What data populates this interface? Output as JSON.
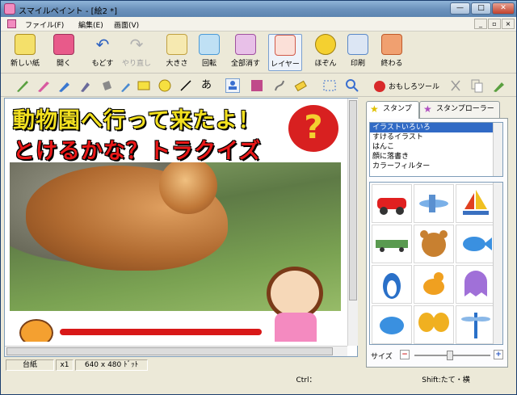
{
  "window": {
    "title": "スマイルペイント - [絵2 *]",
    "min": "—",
    "max": "□",
    "close": "✕"
  },
  "menu": {
    "items": [
      "ファイル(F)",
      "編集(E)",
      "画面(V)"
    ],
    "mdi": [
      "_",
      "▫",
      "×"
    ]
  },
  "toolbar": [
    {
      "label": "新しい紙",
      "icon": "new-paper-icon",
      "color": "#f4e06a",
      "enabled": true
    },
    {
      "label": "開く",
      "icon": "open-icon",
      "color": "#e85a8a",
      "enabled": true
    },
    {
      "label": "もどす",
      "icon": "undo-icon",
      "color": "#3a6fd0",
      "enabled": true
    },
    {
      "label": "やり直し",
      "icon": "redo-icon",
      "color": "#b8b8b8",
      "enabled": false
    },
    {
      "label": "大きさ",
      "icon": "resize-icon",
      "color": "#f0c040",
      "enabled": true
    },
    {
      "label": "回転",
      "icon": "rotate-icon",
      "color": "#4a9ad8",
      "enabled": true
    },
    {
      "label": "全部消す",
      "icon": "clear-all-icon",
      "color": "#c070c0",
      "enabled": true
    },
    {
      "label": "レイヤー",
      "icon": "layer-icon",
      "color": "#e85a4a",
      "enabled": true
    },
    {
      "label": "ほぞん",
      "icon": "save-icon",
      "color": "#f4d030",
      "enabled": true
    },
    {
      "label": "印刷",
      "icon": "print-icon",
      "color": "#5a88c8",
      "enabled": true
    },
    {
      "label": "終わる",
      "icon": "exit-icon",
      "color": "#e86a3a",
      "enabled": true
    }
  ],
  "tools": {
    "text_tool": "あ",
    "fun_tool": "おもしろツール"
  },
  "canvas": {
    "line1": "動物園へ行って来たよ！",
    "line2": "とけるかな？トラクイズ",
    "question": "?"
  },
  "panel": {
    "tabs": [
      "スタンプ",
      "スタンプローラー"
    ],
    "categories": [
      "イラストいろいろ",
      "すけるイラスト",
      "はんこ",
      "顔に落書き",
      "カラーフィルター"
    ],
    "selected_category": 0,
    "stamps": [
      "car",
      "airplane",
      "sailboat",
      "train",
      "bear",
      "fish",
      "penguin",
      "bird-orange",
      "ghost",
      "bluebird",
      "butterfly",
      "dragonfly"
    ],
    "size_label": "サイズ"
  },
  "status": {
    "layer": "台紙",
    "zoom": "x1",
    "dimensions": "640 x 480 ﾄﾞｯﾄ",
    "ctrl": "Ctrl：",
    "shift": "Shift:たて・横"
  }
}
